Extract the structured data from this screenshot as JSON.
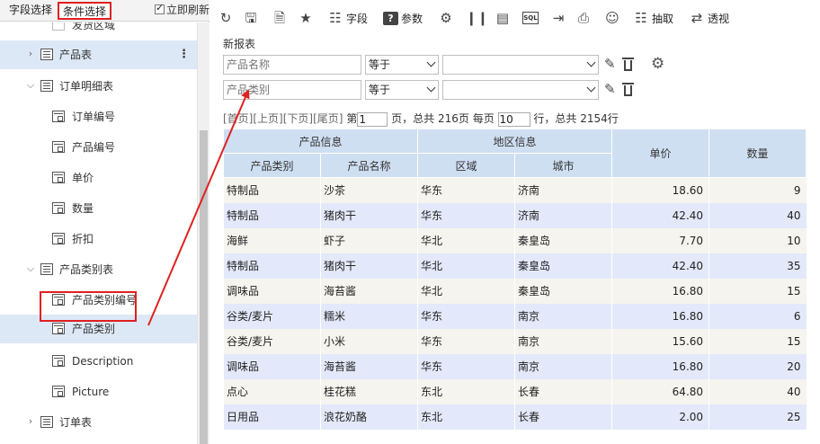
{
  "left_panel": {
    "tabs": [
      "字段选择",
      "条件选择"
    ],
    "auto_refresh": "立即刷新",
    "tree": [
      {
        "label": "发货区域",
        "type": "field",
        "faded": true
      },
      {
        "label": "产品表",
        "type": "table",
        "expanded": false
      },
      {
        "label": "订单明细表",
        "type": "table",
        "expanded": true
      },
      {
        "label": "订单编号",
        "type": "field"
      },
      {
        "label": "产品编号",
        "type": "field"
      },
      {
        "label": "单价",
        "type": "field"
      },
      {
        "label": "数量",
        "type": "field"
      },
      {
        "label": "折扣",
        "type": "field"
      },
      {
        "label": "产品类别表",
        "type": "table",
        "expanded": true
      },
      {
        "label": "产品类别编号",
        "type": "field"
      },
      {
        "label": "产品类别",
        "type": "field",
        "selected": true
      },
      {
        "label": "Description",
        "type": "field"
      },
      {
        "label": "Picture",
        "type": "field"
      },
      {
        "label": "订单表",
        "type": "table",
        "expanded": false
      }
    ]
  },
  "toolbar": {
    "items": [
      {
        "icon": "refresh-icon",
        "label": ""
      },
      {
        "icon": "save-icon",
        "label": ""
      },
      {
        "icon": "save-as-icon",
        "label": ""
      },
      {
        "icon": "star-icon",
        "label": ""
      },
      {
        "icon": "field-icon",
        "label": "字段"
      },
      {
        "icon": "param-icon",
        "label": "参数"
      },
      {
        "icon": "gear-icon",
        "label": ""
      },
      {
        "icon": "bar-chart-icon",
        "label": ""
      },
      {
        "icon": "table-view-icon",
        "label": ""
      },
      {
        "icon": "sql-icon",
        "label": ""
      },
      {
        "icon": "export-icon",
        "label": ""
      },
      {
        "icon": "print-icon",
        "label": ""
      },
      {
        "icon": "user-settings-icon",
        "label": ""
      },
      {
        "icon": "extract-icon",
        "label": "抽取"
      },
      {
        "icon": "pivot-icon",
        "label": "透视"
      }
    ],
    "sql_text": "SQL",
    "param_text": "?"
  },
  "report": {
    "title": "新报表",
    "conditions": [
      {
        "field_placeholder": "产品名称",
        "operator": "等于",
        "value": ""
      },
      {
        "field_placeholder": "产品类别",
        "operator": "等于",
        "value": ""
      }
    ],
    "pager": {
      "first": "[首页]",
      "prev": "[上页]",
      "next": "[下页]",
      "last": "[尾页]",
      "page_prefix": "第",
      "page": "1",
      "page_suffix": "页，总共 216页 每页",
      "per_page": "10",
      "rows_suffix": "行，总共 2154行"
    },
    "grid": {
      "group_headers": [
        "产品信息",
        "地区信息",
        "单价",
        "数量"
      ],
      "sub_headers": [
        "产品类别",
        "产品名称",
        "区域",
        "城市"
      ],
      "rows": [
        [
          "特制品",
          "沙茶",
          "华东",
          "济南",
          "18.60",
          "9"
        ],
        [
          "特制品",
          "猪肉干",
          "华东",
          "济南",
          "42.40",
          "40"
        ],
        [
          "海鲜",
          "虾子",
          "华北",
          "秦皇岛",
          "7.70",
          "10"
        ],
        [
          "特制品",
          "猪肉干",
          "华北",
          "秦皇岛",
          "42.40",
          "35"
        ],
        [
          "调味品",
          "海苔酱",
          "华北",
          "秦皇岛",
          "16.80",
          "15"
        ],
        [
          "谷类/麦片",
          "糯米",
          "华东",
          "南京",
          "16.80",
          "6"
        ],
        [
          "谷类/麦片",
          "小米",
          "华东",
          "南京",
          "15.60",
          "15"
        ],
        [
          "调味品",
          "海苔酱",
          "华东",
          "南京",
          "16.80",
          "20"
        ],
        [
          "点心",
          "桂花糕",
          "东北",
          "长春",
          "64.80",
          "40"
        ],
        [
          "日用品",
          "浪花奶酪",
          "东北",
          "长春",
          "2.00",
          "25"
        ]
      ]
    }
  },
  "colors": {
    "annotation_red": "#e02020",
    "header_blue": "#cfdff2",
    "row_odd": "#f6f4ef",
    "row_even": "#e3e9fa",
    "selected_tree": "#dde8f6"
  }
}
